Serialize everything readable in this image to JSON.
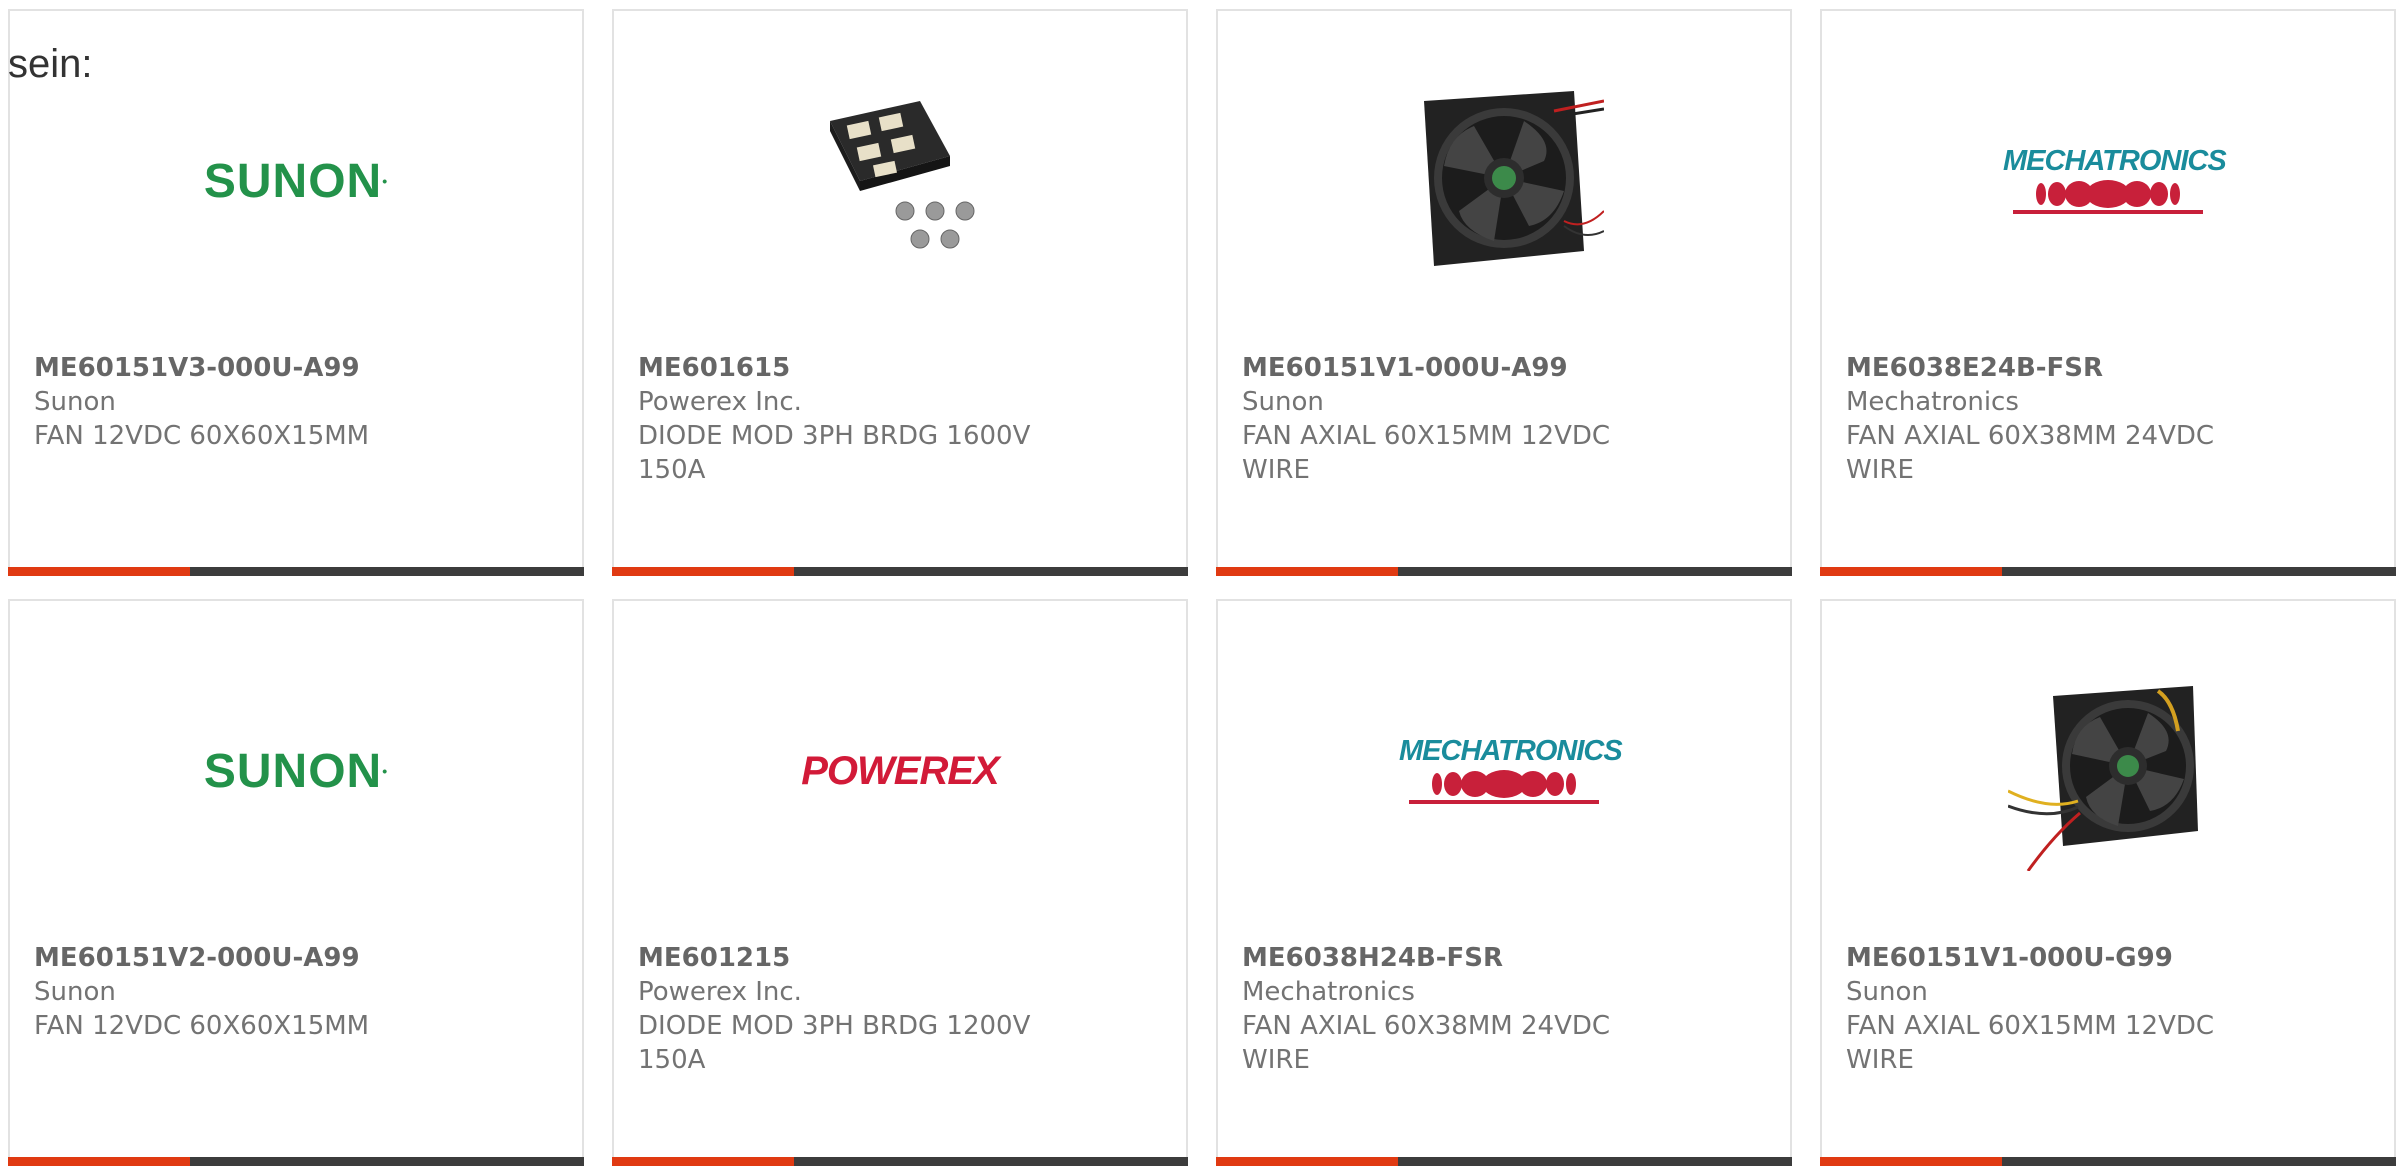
{
  "intro_text": "sein:",
  "colors": {
    "accent_bar": "#e03a12",
    "bar_dark": "#3c3c3c",
    "sunon_green": "#23924a",
    "mechatronics_teal": "#1a8c9c",
    "mechatronics_red": "#c8203a",
    "powerex_red": "#d21a38"
  },
  "products": [
    {
      "part_number": "ME60151V3-000U-A99",
      "manufacturer": "Sunon",
      "description": "FAN 12VDC 60X60X15MM",
      "image": "sunon-logo",
      "logo_text": "SUNON"
    },
    {
      "part_number": "ME601615",
      "manufacturer": "Powerex Inc.",
      "description": "DIODE MOD 3PH BRDG 1600V 150A",
      "image": "diode-module-photo"
    },
    {
      "part_number": "ME60151V1-000U-A99",
      "manufacturer": "Sunon",
      "description": "FAN AXIAL 60X15MM 12VDC WIRE",
      "image": "fan-photo"
    },
    {
      "part_number": "ME6038E24B-FSR",
      "manufacturer": "Mechatronics",
      "description": "FAN AXIAL 60X38MM 24VDC WIRE",
      "image": "mechatronics-logo",
      "logo_text": "MECHATRONICS"
    },
    {
      "part_number": "ME60151V2-000U-A99",
      "manufacturer": "Sunon",
      "description": "FAN 12VDC 60X60X15MM",
      "image": "sunon-logo",
      "logo_text": "SUNON"
    },
    {
      "part_number": "ME601215",
      "manufacturer": "Powerex Inc.",
      "description": "DIODE MOD 3PH BRDG 1200V 150A",
      "image": "powerex-logo",
      "logo_text": "POWEREX"
    },
    {
      "part_number": "ME6038H24B-FSR",
      "manufacturer": "Mechatronics",
      "description": "FAN AXIAL 60X38MM 24VDC WIRE",
      "image": "mechatronics-logo",
      "logo_text": "MECHATRONICS"
    },
    {
      "part_number": "ME60151V1-000U-G99",
      "manufacturer": "Sunon",
      "description": "FAN AXIAL 60X15MM 12VDC WIRE",
      "image": "fan-photo-wires"
    }
  ]
}
